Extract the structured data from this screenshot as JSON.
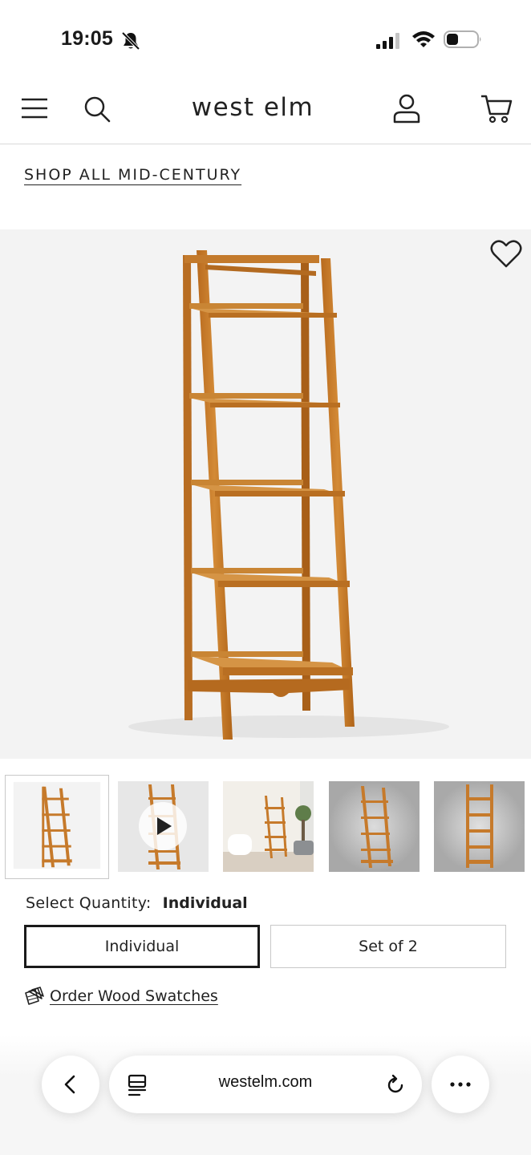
{
  "status_bar": {
    "time": "19:05",
    "icons": [
      "bell-slash-icon",
      "cellular-signal-icon",
      "wifi-icon",
      "battery-icon"
    ]
  },
  "header": {
    "brand": "west elm",
    "icons": [
      "menu-icon",
      "search-icon",
      "account-icon",
      "cart-icon"
    ]
  },
  "breadcrumb": {
    "shop_all": "SHOP ALL MID-CENTURY"
  },
  "product": {
    "image_alt": "Mid-century ladder bookshelf in acorn wood",
    "wishlist_icon": "heart-icon",
    "wood_color": "#c47a2a"
  },
  "thumbnails": [
    {
      "name": "thumb-1",
      "selected": true,
      "kind": "product"
    },
    {
      "name": "thumb-2",
      "selected": false,
      "kind": "video"
    },
    {
      "name": "thumb-3",
      "selected": false,
      "kind": "room"
    },
    {
      "name": "thumb-4",
      "selected": false,
      "kind": "product-grey"
    },
    {
      "name": "thumb-5",
      "selected": false,
      "kind": "product-grey"
    }
  ],
  "quantity": {
    "label": "Select Quantity:",
    "value": "Individual",
    "options": [
      "Individual",
      "Set of 2"
    ],
    "selected": "Individual"
  },
  "swatches": {
    "link_text": "Order Wood Swatches"
  },
  "browser": {
    "url": "westelm.com",
    "icons": [
      "back-chevron-icon",
      "reader-icon",
      "reload-icon",
      "more-icon"
    ]
  }
}
